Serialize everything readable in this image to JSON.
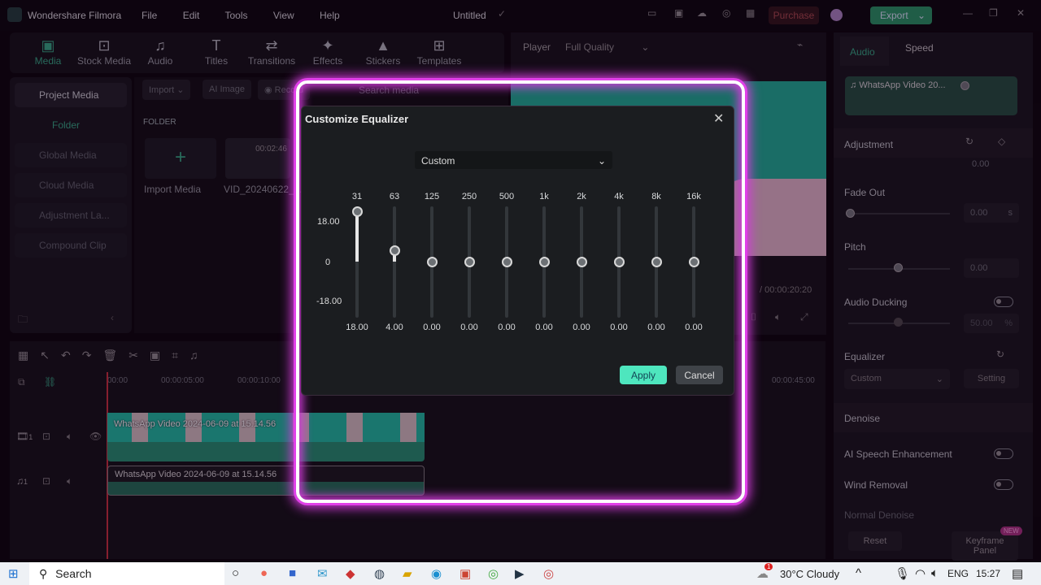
{
  "app": {
    "name": "Wondershare Filmora",
    "title": "Untitled",
    "menu": [
      "File",
      "Edit",
      "Tools",
      "View",
      "Help"
    ],
    "purchase": "Purchase",
    "export": "Export"
  },
  "toolbar": [
    {
      "label": "Media",
      "icon": "media-icon"
    },
    {
      "label": "Stock Media",
      "icon": "stock-media-icon"
    },
    {
      "label": "Audio",
      "icon": "music-note-icon"
    },
    {
      "label": "Titles",
      "icon": "titles-icon"
    },
    {
      "label": "Transitions",
      "icon": "transitions-icon"
    },
    {
      "label": "Effects",
      "icon": "effects-icon"
    },
    {
      "label": "Stickers",
      "icon": "stickers-icon"
    },
    {
      "label": "Templates",
      "icon": "templates-icon"
    }
  ],
  "sidebar": {
    "project_media": "Project Media",
    "folder": "Folder",
    "items": [
      "Global Media",
      "Cloud Media",
      "Adjustment La...",
      "Compound Clip"
    ]
  },
  "media": {
    "import": "Import",
    "ai_image": "AI Image",
    "record": "Record",
    "search_placeholder": "Search media",
    "folder_label": "FOLDER",
    "import_media": "Import Media",
    "clip_name": "VID_20240622_1...",
    "clip_duration": "00:02:46"
  },
  "player": {
    "label": "Player",
    "quality": "Full Quality",
    "total_time": "00:00:20:20"
  },
  "timeline": {
    "ticks": [
      "00:00",
      "00:00:05:00",
      "00:00:10:00",
      "00:00:45:00"
    ],
    "video_clip": "WhatsApp Video 2024-06-09 at 15.14.56",
    "audio_clip": "WhatsApp Video 2024-06-09 at 15.14.56",
    "video_track": "1",
    "audio_track": "1"
  },
  "right": {
    "tabs": [
      "Audio",
      "Speed"
    ],
    "clip": "WhatsApp Video 20...",
    "adjustment": "Adjustment",
    "fade_in_value": "0.00",
    "fade_out": "Fade Out",
    "fade_out_value": "0.00",
    "unit_s": "s",
    "pitch": "Pitch",
    "pitch_value": "0.00",
    "audio_ducking": "Audio Ducking",
    "ducking_value": "50.00",
    "unit_pct": "%",
    "equalizer": "Equalizer",
    "eq_preset": "Custom",
    "setting": "Setting",
    "denoise": "Denoise",
    "ai_speech": "AI Speech Enhancement",
    "wind": "Wind Removal",
    "normal_denoise": "Normal Denoise",
    "reset": "Reset",
    "keyframe": "Keyframe Panel",
    "new_badge": "NEW"
  },
  "dialog": {
    "title": "Customize Equalizer",
    "preset": "Custom",
    "scale": {
      "max": "18.00",
      "zero": "0",
      "min": "-18.00"
    },
    "bands": [
      {
        "freq": "31",
        "value": 18
      },
      {
        "freq": "63",
        "value": 4
      },
      {
        "freq": "125",
        "value": 0
      },
      {
        "freq": "250",
        "value": 0
      },
      {
        "freq": "500",
        "value": 0
      },
      {
        "freq": "1k",
        "value": 0
      },
      {
        "freq": "2k",
        "value": 0
      },
      {
        "freq": "4k",
        "value": 0
      },
      {
        "freq": "8k",
        "value": 0
      },
      {
        "freq": "16k",
        "value": 0
      }
    ],
    "apply": "Apply",
    "cancel": "Cancel"
  },
  "taskbar": {
    "search": "Search",
    "weather": "30°C  Cloudy",
    "lang": "ENG",
    "time": "15:27",
    "notif": "1"
  }
}
